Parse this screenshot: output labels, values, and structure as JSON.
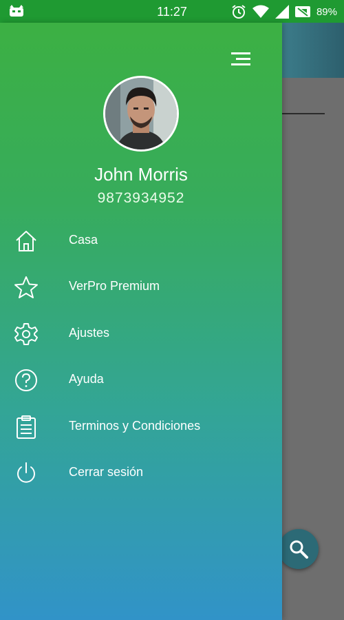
{
  "status_bar": {
    "time": "11:27",
    "battery": "89%",
    "icons": [
      "app-notification-icon",
      "alarm-icon",
      "wifi-icon",
      "signal-icon",
      "no-sim-icon"
    ]
  },
  "colors": {
    "drawer_top": "#3cb043",
    "drawer_bottom": "#3193c8",
    "status_bar": "#1f9a32",
    "text": "#ffffff"
  },
  "drawer": {
    "user_name": "John Morris",
    "user_phone": "9873934952",
    "menu_icon": "hamburger-menu-icon",
    "items": [
      {
        "label": "Casa",
        "icon": "home-icon"
      },
      {
        "label": "VerPro Premium",
        "icon": "star-icon"
      },
      {
        "label": "Ajustes",
        "icon": "gear-icon"
      },
      {
        "label": "Ayuda",
        "icon": "help-icon"
      },
      {
        "label": "Terminos y Condiciones",
        "icon": "clipboard-icon"
      },
      {
        "label": "Cerrar sesión",
        "icon": "power-icon"
      }
    ]
  },
  "background_app": {
    "fab_icon": "search-icon"
  }
}
